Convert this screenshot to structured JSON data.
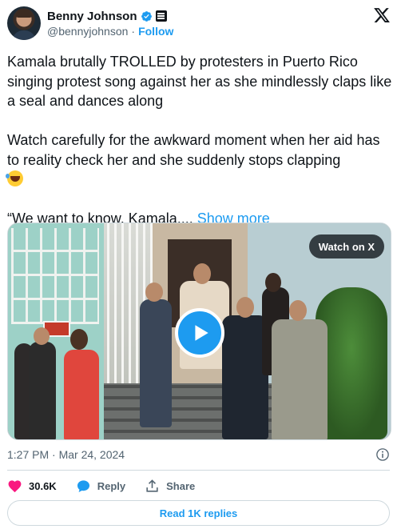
{
  "author": {
    "display_name": "Benny Johnson",
    "handle": "@bennyjohnson",
    "separator": "·",
    "follow_label": "Follow",
    "verified_icon": "verified-badge-icon",
    "affiliation_icon": "affiliate-badge-icon"
  },
  "tweet": {
    "line1": "Kamala brutally TROLLED by protesters in Puerto Rico singing protest song against her as she mindlessly claps like a seal and dances along",
    "line2": "Watch carefully for the awkward moment when her aid has to reality check her and she suddenly stops clapping",
    "line3_prefix": "“We want to know, Kamala,... ",
    "show_more": "Show more"
  },
  "media": {
    "watch_label": "Watch on X",
    "play_icon": "play-icon"
  },
  "meta": {
    "timestamp": "1:27 PM · Mar 24, 2024"
  },
  "actions": {
    "like_count": "30.6K",
    "reply_label": "Reply",
    "share_label": "Share"
  },
  "footer": {
    "replies_label": "Read 1K replies"
  },
  "colors": {
    "accent": "#1d9bf0",
    "like": "#f91880",
    "text": "#0f1419",
    "muted": "#536471"
  }
}
